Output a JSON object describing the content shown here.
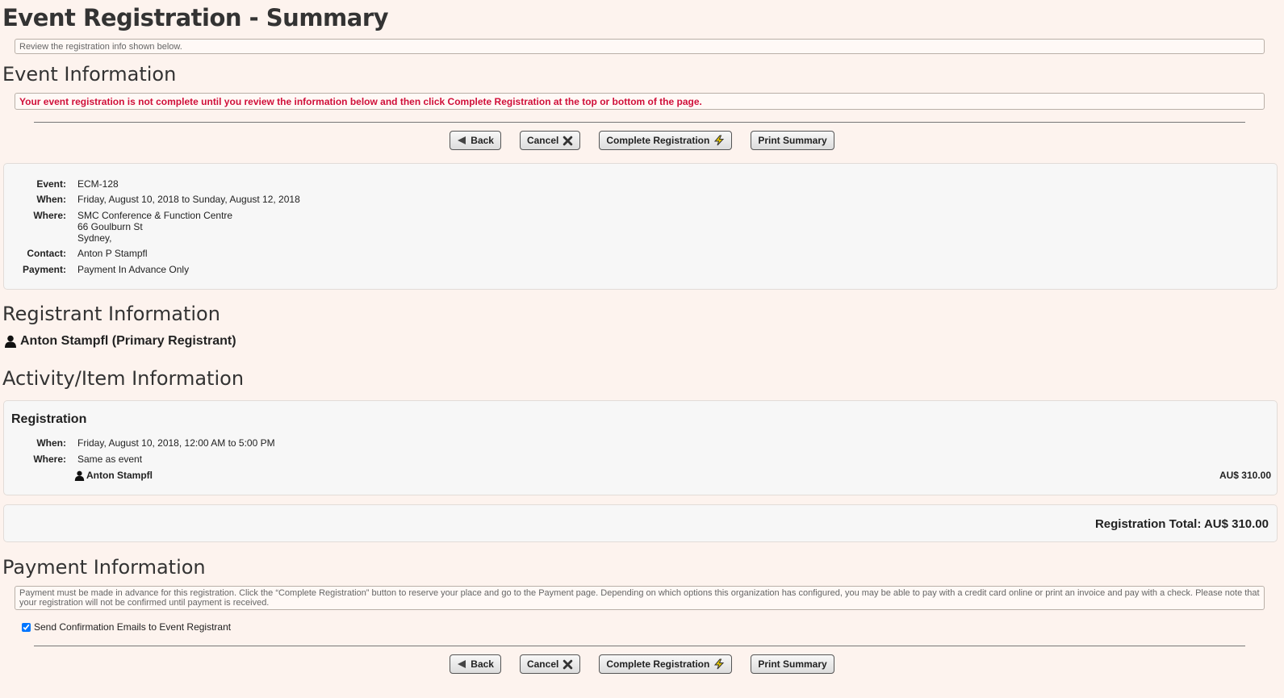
{
  "header": {
    "title": "Event Registration - Summary",
    "review_notice": "Review the registration info shown below."
  },
  "event_section": {
    "title": "Event Information",
    "alert": "Your event registration is not complete until you review the information below and then click Complete Registration at the top or bottom of the page."
  },
  "buttons": {
    "back": "Back",
    "cancel": "Cancel",
    "complete": "Complete Registration",
    "print": "Print Summary"
  },
  "event_details": {
    "event_label": "Event:",
    "event_value": "ECM-128",
    "when_label": "When:",
    "when_value": "Friday, August 10, 2018 to Sunday, August 12, 2018",
    "where_label": "Where:",
    "where_line1": "SMC Conference & Function Centre",
    "where_line2": "66 Goulburn St",
    "where_line3": "Sydney,",
    "contact_label": "Contact:",
    "contact_value": "Anton P Stampfl",
    "payment_label": "Payment:",
    "payment_value": "Payment In Advance Only"
  },
  "registrant_section": {
    "title": "Registrant Information",
    "primary": "Anton Stampfl (Primary Registrant)"
  },
  "activity_section": {
    "title": "Activity/Item Information",
    "item_title": "Registration",
    "when_label": "When:",
    "when_value": "Friday, August 10, 2018, 12:00 AM to 5:00 PM",
    "where_label": "Where:",
    "where_value": "Same as event",
    "attendee": "Anton Stampfl",
    "price": "AU$ 310.00"
  },
  "total": {
    "text": "Registration Total: AU$ 310.00"
  },
  "payment_section": {
    "title": "Payment Information",
    "notice": "Payment must be made in advance for this registration. Click the “Complete Registration” button to reserve your place and go to the Payment page. Depending on which options this organization has configured, you may be able to pay with a credit card online or print an invoice and pay with a check. Please note that your registration will not be confirmed until payment is received.",
    "send_email_label": "Send Confirmation Emails to Event Registrant",
    "send_email_checked": true
  },
  "icons": {
    "back": "back-arrow-icon",
    "cancel": "x-icon",
    "complete": "lightning-icon",
    "person": "person-icon"
  },
  "colors": {
    "alert": "#d0103a",
    "background": "#fdf3ee",
    "lightning": "#e6c800"
  }
}
